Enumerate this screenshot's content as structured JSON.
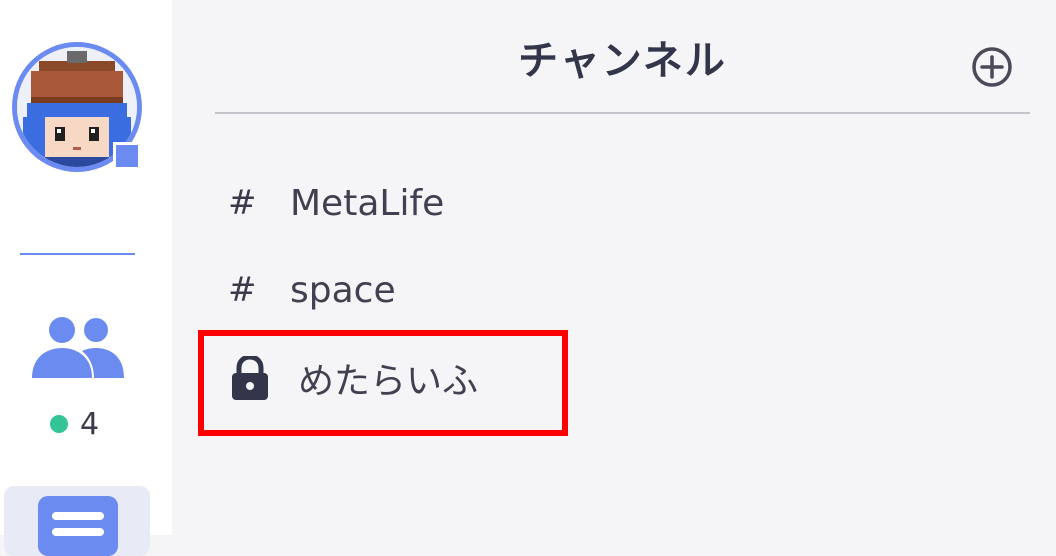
{
  "sidebar": {
    "online_count": "4"
  },
  "header": {
    "title": "チャンネル"
  },
  "channels": [
    {
      "icon": "hash",
      "prefix": "#",
      "label": "MetaLife"
    },
    {
      "icon": "hash",
      "prefix": "#",
      "label": "space"
    },
    {
      "icon": "lock-icon",
      "label": "めたらいふ"
    }
  ],
  "colors": {
    "accent": "#6b8bf0",
    "online": "#35c496",
    "highlight": "#ff0000"
  }
}
